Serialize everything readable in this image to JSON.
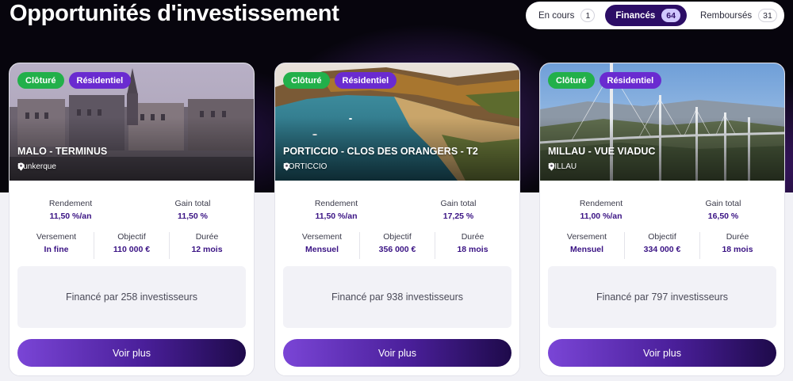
{
  "header": {
    "title": "Opportunités d'investissement"
  },
  "filters": [
    {
      "label": "En cours",
      "count": "1",
      "active": false
    },
    {
      "label": "Financés",
      "count": "64",
      "active": true
    },
    {
      "label": "Remboursés",
      "count": "31",
      "active": false
    }
  ],
  "labels": {
    "rendement": "Rendement",
    "gain_total": "Gain total",
    "versement": "Versement",
    "objectif": "Objectif",
    "duree": "Durée",
    "more_button": "Voir plus"
  },
  "cards": [
    {
      "status_badge": "Clôturé",
      "type_badge": "Résidentiel",
      "title": "MALO - TERMINUS",
      "location": "Dunkerque",
      "rendement": "11,50 %/an",
      "gain_total": "11,50 %",
      "versement": "In fine",
      "objectif": "110 000 €",
      "duree": "12 mois",
      "investors": "Financé par 258 investisseurs"
    },
    {
      "status_badge": "Clôturé",
      "type_badge": "Résidentiel",
      "title": "PORTICCIO - CLOS DES ORANGERS - T2",
      "location": "PORTICCIO",
      "rendement": "11,50 %/an",
      "gain_total": "17,25 %",
      "versement": "Mensuel",
      "objectif": "356 000 €",
      "duree": "18 mois",
      "investors": "Financé par 938 investisseurs"
    },
    {
      "status_badge": "Clôturé",
      "type_badge": "Résidentiel",
      "title": "MILLAU - VUE VIADUC",
      "location": "MILLAU",
      "rendement": "11,00 %/an",
      "gain_total": "16,50 %",
      "versement": "Mensuel",
      "objectif": "334 000 €",
      "duree": "18 mois",
      "investors": "Financé par 797 investisseurs"
    }
  ]
}
